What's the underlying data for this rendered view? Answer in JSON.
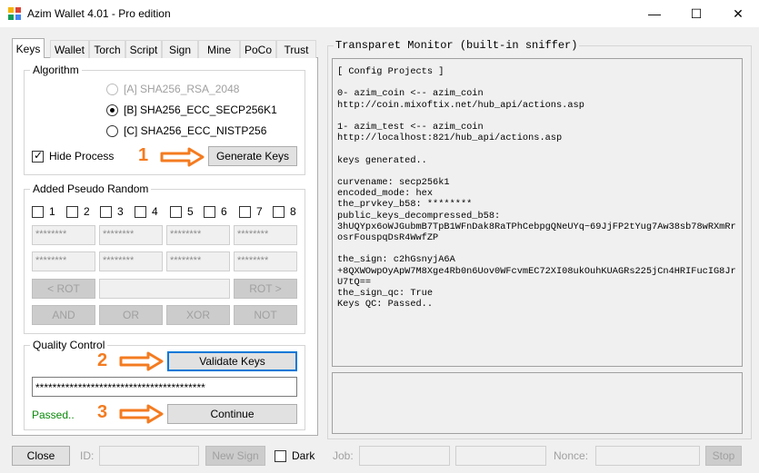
{
  "window": {
    "title": "Azim Wallet 4.01 - Pro edition",
    "minimize": "—",
    "maximize": "☐",
    "close": "✕"
  },
  "tabs": [
    "Keys",
    "Wallet",
    "Torch",
    "Script",
    "Sign",
    "Mine",
    "PoCo",
    "Trust"
  ],
  "algorithm": {
    "legend": "Algorithm",
    "options": [
      "[A] SHA256_RSA_2048",
      "[B] SHA256_ECC_SECP256K1",
      "[C] SHA256_ECC_NISTP256"
    ],
    "selected": 1,
    "hide_process_label": "Hide Process",
    "generate_label": "Generate Keys"
  },
  "pseudo": {
    "legend": "Added Pseudo Random",
    "checks": [
      "1",
      "2",
      "3",
      "4",
      "5",
      "6",
      "7",
      "8"
    ],
    "masked": "********",
    "rot_left": "< ROT",
    "rot_right": "ROT >",
    "and": "AND",
    "or": "OR",
    "xor": "XOR",
    "not": "NOT"
  },
  "quality": {
    "legend": "Quality Control",
    "validate_label": "Validate Keys",
    "key_value": "****************************************",
    "status": "Passed..",
    "continue_label": "Continue"
  },
  "steps": [
    "1",
    "2",
    "3"
  ],
  "bottom": {
    "close_label": "Close",
    "id_label": "ID:",
    "new_sign_label": "New Sign",
    "dark_label": "Dark",
    "job_label": "Job:",
    "nonce_label": "Nonce:",
    "stop_label": "Stop"
  },
  "monitor": {
    "title": "Transparet Monitor (built-in sniffer)",
    "log": "[ Config Projects ]\n\n0- azim_coin <-- azim_coin\nhttp://coin.mixoftix.net/hub_api/actions.asp\n\n1- azim_test <-- azim_coin\nhttp://localhost:821/hub_api/actions.asp\n\nkeys generated..\n\ncurvename: secp256k1\nencoded_mode: hex\nthe_prvkey_b58: ********\npublic_keys_decompressed_b58:\n3hUQYpx6oWJGubmB7TpB1WFnDak8RaTPhCebpgQNeUYq~69JjFP2tYug7Aw38sb78wRXmRrosrFouspqDsR4WwfZP\n\nthe_sign: c2hGsnyjA6A\n+8QXWOwpOyApW7M8Xge4Rb0n6Uov0WFcvmEC72XI08ukOuhKUAGRs225jCn4HRIFucIG8JrU7tQ==\nthe_sign_qc: True\nKeys QC: Passed.."
  },
  "colors": {
    "accent_arrow": "#f47b20",
    "focus_border": "#0078d7",
    "status_green": "#0a8a0a"
  }
}
